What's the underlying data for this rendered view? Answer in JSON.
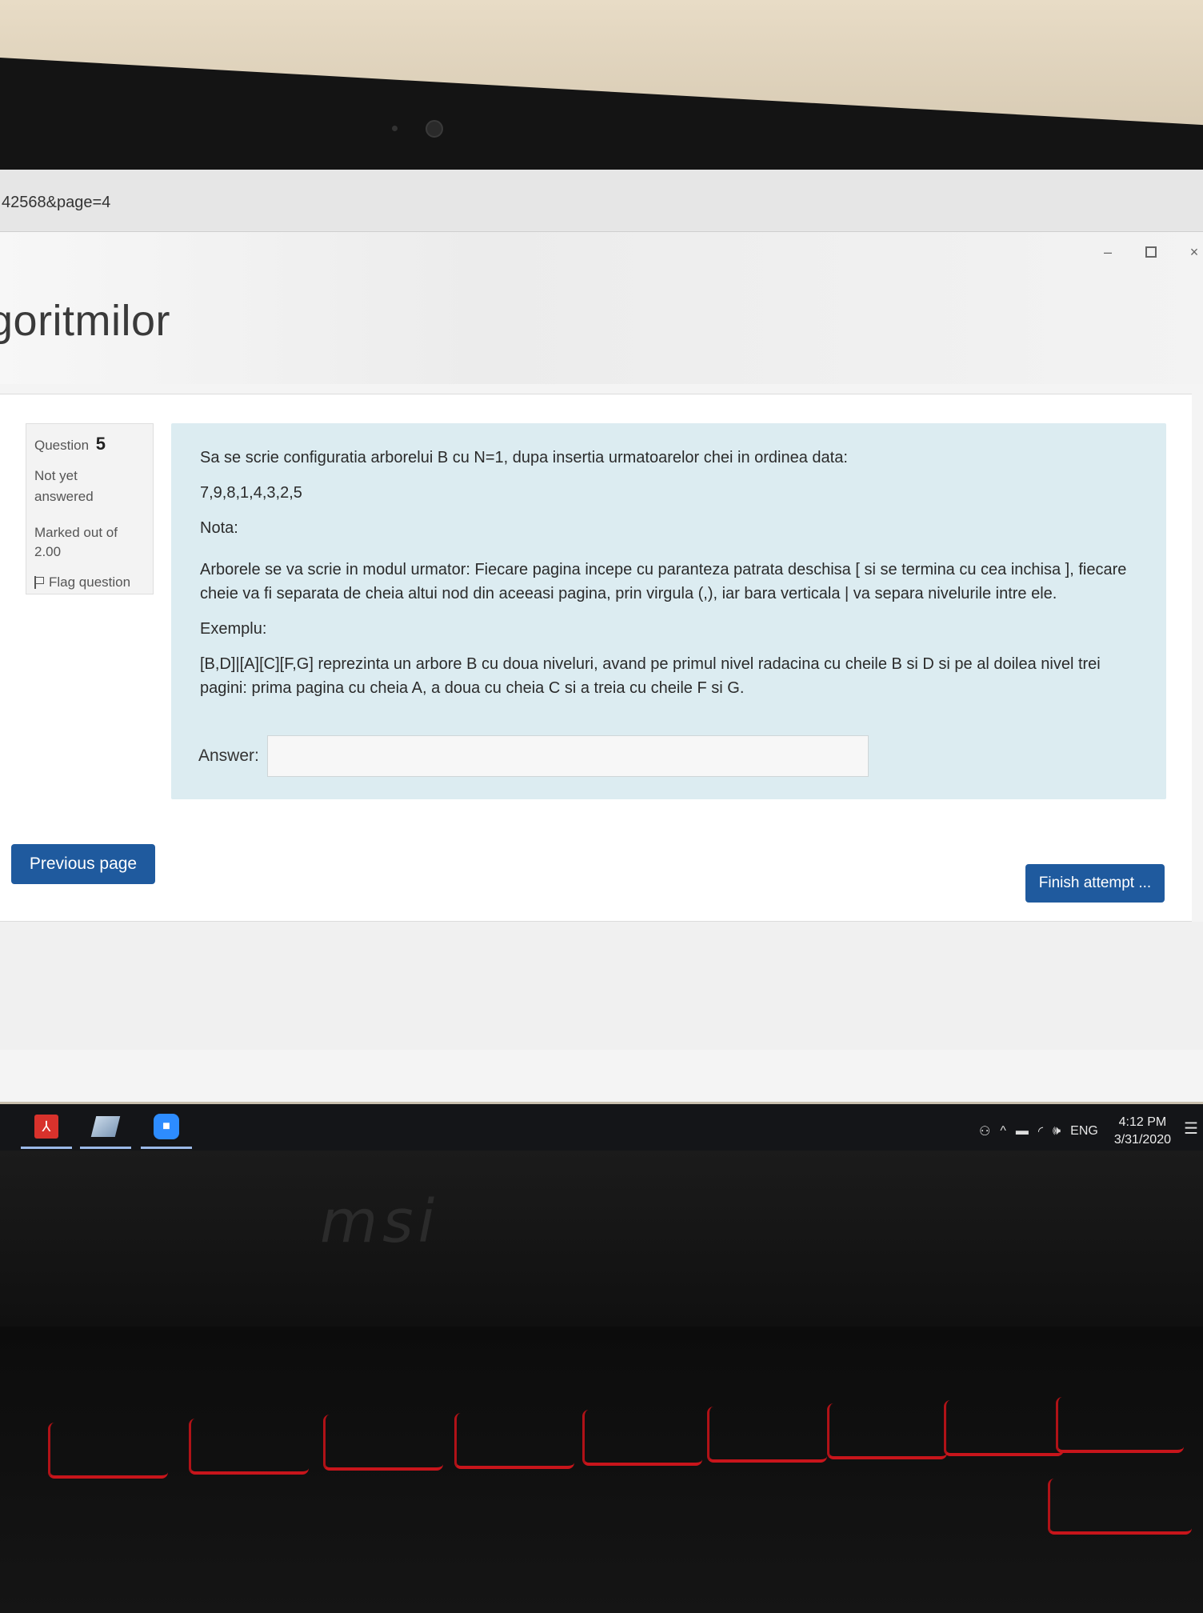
{
  "browser": {
    "url_fragment": "42568&page=4",
    "window_controls": {
      "minimize": "–",
      "maximize": "",
      "close": "×"
    }
  },
  "course": {
    "title_fragment": "goritmilor"
  },
  "question_info": {
    "label": "Question",
    "number": "5",
    "state": "Not yet answered",
    "grade": "Marked out of 2.00",
    "flag_label": "Flag question"
  },
  "question": {
    "line1": "Sa se scrie configuratia arborelui B cu N=1, dupa insertia urmatoarelor chei in ordinea data:",
    "keys": "7,9,8,1,4,3,2,5",
    "nota": "Nota:",
    "description": "Arborele se va scrie in modul urmator: Fiecare pagina incepe cu paranteza patrata deschisa [ si se termina cu cea inchisa ], fiecare cheie va fi separata de cheia altui nod din aceeasi pagina, prin virgula (,), iar bara verticala | va separa nivelurile intre ele.",
    "example_label": "Exemplu:",
    "example_text": "[B,D]|[A][C][F,G] reprezinta un arbore B cu doua niveluri, avand pe primul nivel radacina cu cheile B si D si pe al doilea nivel trei pagini: prima pagina cu cheia A, a doua cu cheia C si a treia cu cheile F si G.",
    "answer_label": "Answer:",
    "answer_value": ""
  },
  "navigation": {
    "previous_label": "Previous page",
    "finish_label": "Finish attempt ..."
  },
  "taskbar": {
    "apps": [
      "pdf-reader-icon",
      "notes-icon",
      "zoom-icon"
    ],
    "language": "ENG",
    "time": "4:12 PM",
    "date": "3/31/2020"
  },
  "hardware": {
    "brand": "msi"
  },
  "colors": {
    "primary_button": "#1f5a9e",
    "question_bg": "#dcecf1",
    "taskbar_bg": "#141518",
    "keyboard_backlight": "#c8151b"
  }
}
